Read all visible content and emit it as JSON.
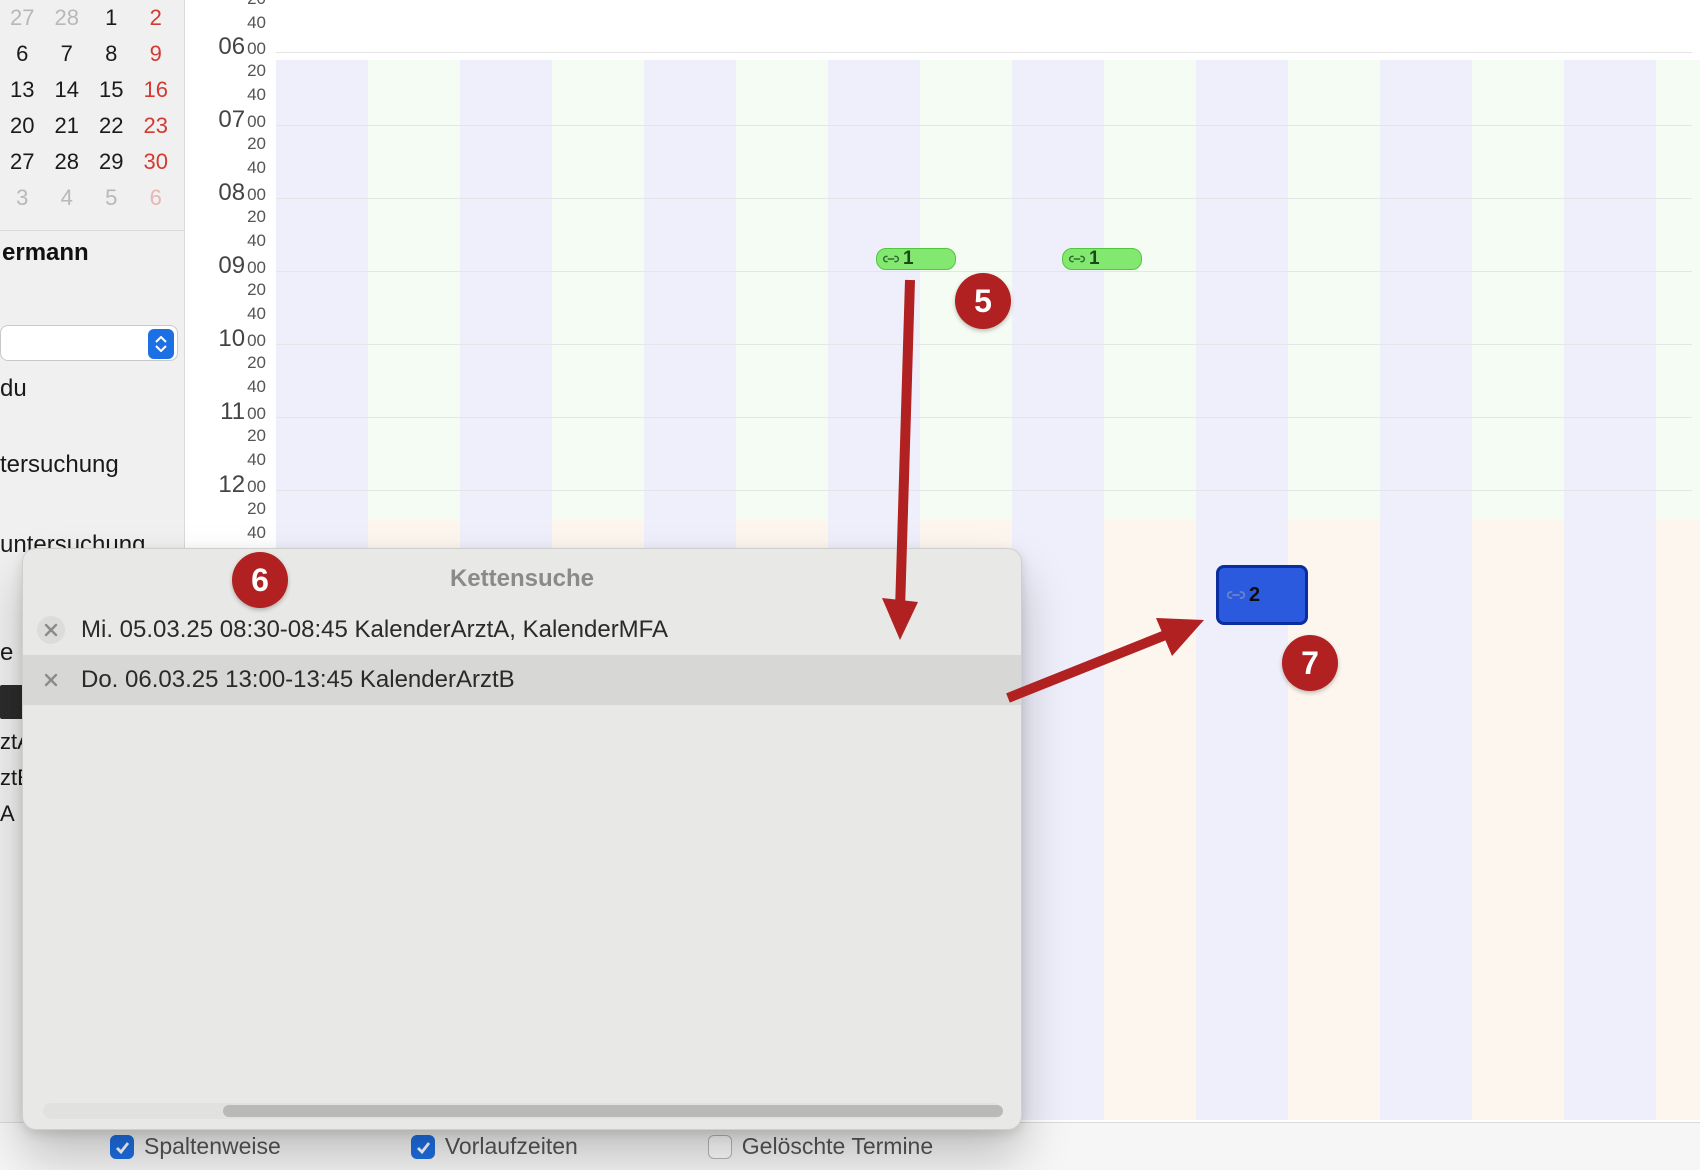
{
  "miniCalendar": {
    "rows": [
      [
        {
          "n": "27",
          "cls": "mc-dim"
        },
        {
          "n": "28",
          "cls": "mc-dim"
        },
        {
          "n": "1",
          "cls": ""
        },
        {
          "n": "2",
          "cls": "mc-sun"
        }
      ],
      [
        {
          "n": "6",
          "cls": ""
        },
        {
          "n": "7",
          "cls": ""
        },
        {
          "n": "8",
          "cls": ""
        },
        {
          "n": "9",
          "cls": "mc-sun"
        }
      ],
      [
        {
          "n": "13",
          "cls": ""
        },
        {
          "n": "14",
          "cls": ""
        },
        {
          "n": "15",
          "cls": ""
        },
        {
          "n": "16",
          "cls": "mc-sun"
        }
      ],
      [
        {
          "n": "20",
          "cls": ""
        },
        {
          "n": "21",
          "cls": ""
        },
        {
          "n": "22",
          "cls": ""
        },
        {
          "n": "23",
          "cls": "mc-sun"
        }
      ],
      [
        {
          "n": "27",
          "cls": ""
        },
        {
          "n": "28",
          "cls": ""
        },
        {
          "n": "29",
          "cls": ""
        },
        {
          "n": "30",
          "cls": "mc-sun"
        }
      ],
      [
        {
          "n": "3",
          "cls": "mc-dim"
        },
        {
          "n": "4",
          "cls": "mc-dim"
        },
        {
          "n": "5",
          "cls": "mc-dim"
        },
        {
          "n": "6",
          "cls": "mc-sun-dim"
        }
      ]
    ]
  },
  "sidebar": {
    "name_fragment": "ermann",
    "word_du": "du",
    "word1": "tersuchung",
    "word2": "untersuchung",
    "abbrs": [
      "ztA",
      "ztE",
      "A"
    ],
    "row_e": "e"
  },
  "timeline": {
    "hours": [
      "06",
      "07",
      "08",
      "09",
      "10",
      "11",
      "12"
    ],
    "sub": [
      "00",
      "20",
      "40"
    ],
    "pill1": {
      "label": "1"
    },
    "pill2": {
      "label": "1"
    },
    "block": {
      "label": "2"
    }
  },
  "popover": {
    "title": "Kettensuche",
    "rows": [
      {
        "text": "Mi.  05.03.25  08:30-08:45 KalenderArztA, KalenderMFA",
        "selected": false
      },
      {
        "text": "Do.  06.03.25  13:00-13:45 KalenderArztB",
        "selected": true
      }
    ]
  },
  "bottom": {
    "cb1": "Spaltenweise",
    "cb2": "Vorlaufzeiten",
    "cb3": "Gelöschte Termine"
  },
  "ann": {
    "a5": "5",
    "a6": "6",
    "a7": "7"
  }
}
